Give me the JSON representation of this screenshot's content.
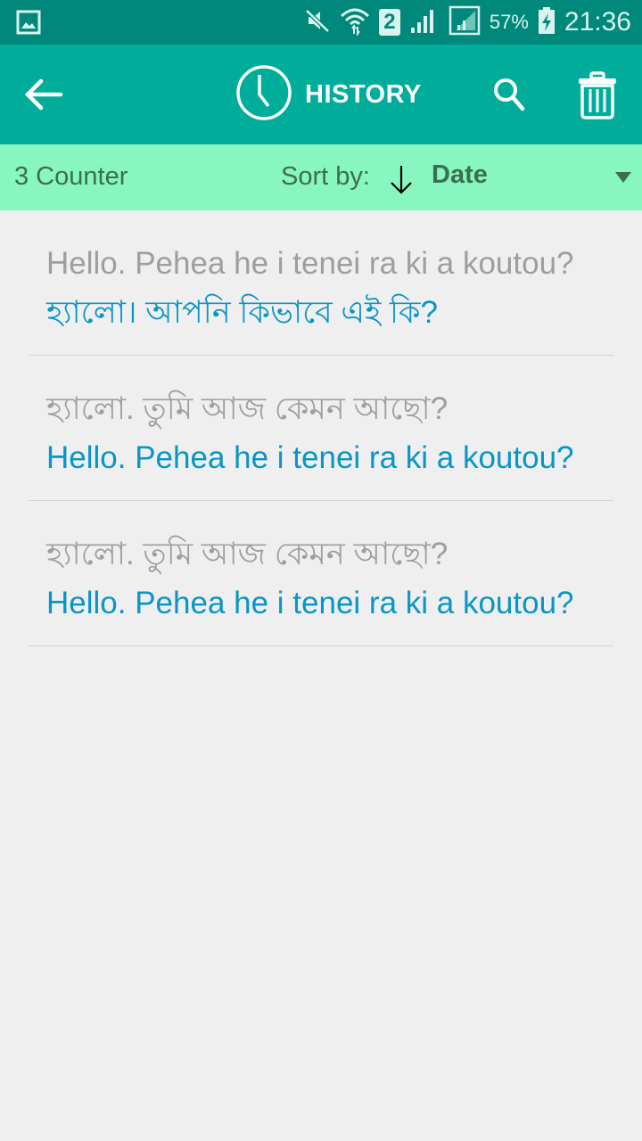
{
  "status_bar": {
    "battery_percent": "57%",
    "time": "21:36",
    "sim_slot": "2",
    "icons": [
      "gallery-notification-icon",
      "mute-icon",
      "wifi-icon",
      "sim-icon",
      "signal-icon",
      "signal-icon-2",
      "battery-charging-icon"
    ]
  },
  "app_bar": {
    "title": "HISTORY",
    "icons": {
      "back": "arrow-left-icon",
      "title": "clock-icon",
      "search": "search-icon",
      "delete": "trash-icon"
    }
  },
  "sort_bar": {
    "counter": "3 Counter",
    "sort_label": "Sort by:",
    "sort_value": "Date",
    "sort_direction_icon": "arrow-down-icon"
  },
  "history": [
    {
      "source": "Hello. Pehea he i tenei ra ki a koutou?",
      "translation": "হ্যালো। আপনি কিভাবে এই কি?"
    },
    {
      "source": "হ্যালো. তুমি আজ কেমন আছো?",
      "translation": "Hello. Pehea he i tenei ra ki a koutou?"
    },
    {
      "source": "হ্যালো. তুমি আজ কেমন আছো?",
      "translation": "Hello. Pehea he i tenei ra ki a koutou?"
    }
  ],
  "colors": {
    "status_bar": "#00897b",
    "app_bar": "#00ac9a",
    "sort_bar": "#87f7bf",
    "source_text": "#9e9e9e",
    "translation_text": "#0996c6",
    "background": "#efefef"
  }
}
